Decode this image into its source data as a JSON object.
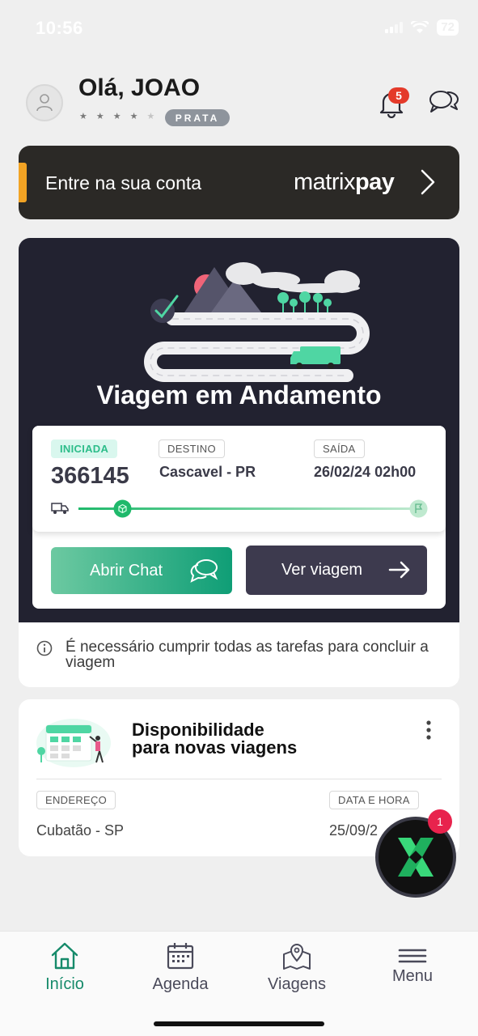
{
  "status_bar": {
    "time": "10:56",
    "battery": "72"
  },
  "header": {
    "greeting": "Olá, JOAO",
    "rating_stars": 4,
    "rating_max": 5,
    "level": "PRATA",
    "notifications_count": "5"
  },
  "matrixpay_banner": {
    "text": "Entre na sua conta",
    "logo_part1": "matrix",
    "logo_part2": "pay",
    "accent_color": "#f2a324"
  },
  "trip": {
    "title": "Viagem em Andamento",
    "status": "INICIADA",
    "number": "366145",
    "destination_label": "DESTINO",
    "destination": "Cascavel - PR",
    "departure_label": "SAÍDA",
    "departure": "26/02/24 02h00",
    "open_chat_label": "Abrir Chat",
    "view_trip_label": "Ver viagem",
    "notice": "É necessário cumprir todas as tarefas para concluir a viagem"
  },
  "availability": {
    "title_line1": "Disponibilidade",
    "title_line2": "para novas viagens",
    "address_label": "ENDEREÇO",
    "address": "Cubatão - SP",
    "datetime_label": "DATA E HORA",
    "datetime": "25/09/2"
  },
  "fab": {
    "badge": "1"
  },
  "nav": {
    "items": [
      {
        "label": "Início",
        "icon": "home-icon"
      },
      {
        "label": "Agenda",
        "icon": "calendar-icon"
      },
      {
        "label": "Viagens",
        "icon": "map-icon"
      },
      {
        "label": "Menu",
        "icon": "hamburger-icon"
      }
    ],
    "active_color": "#168a6a"
  }
}
